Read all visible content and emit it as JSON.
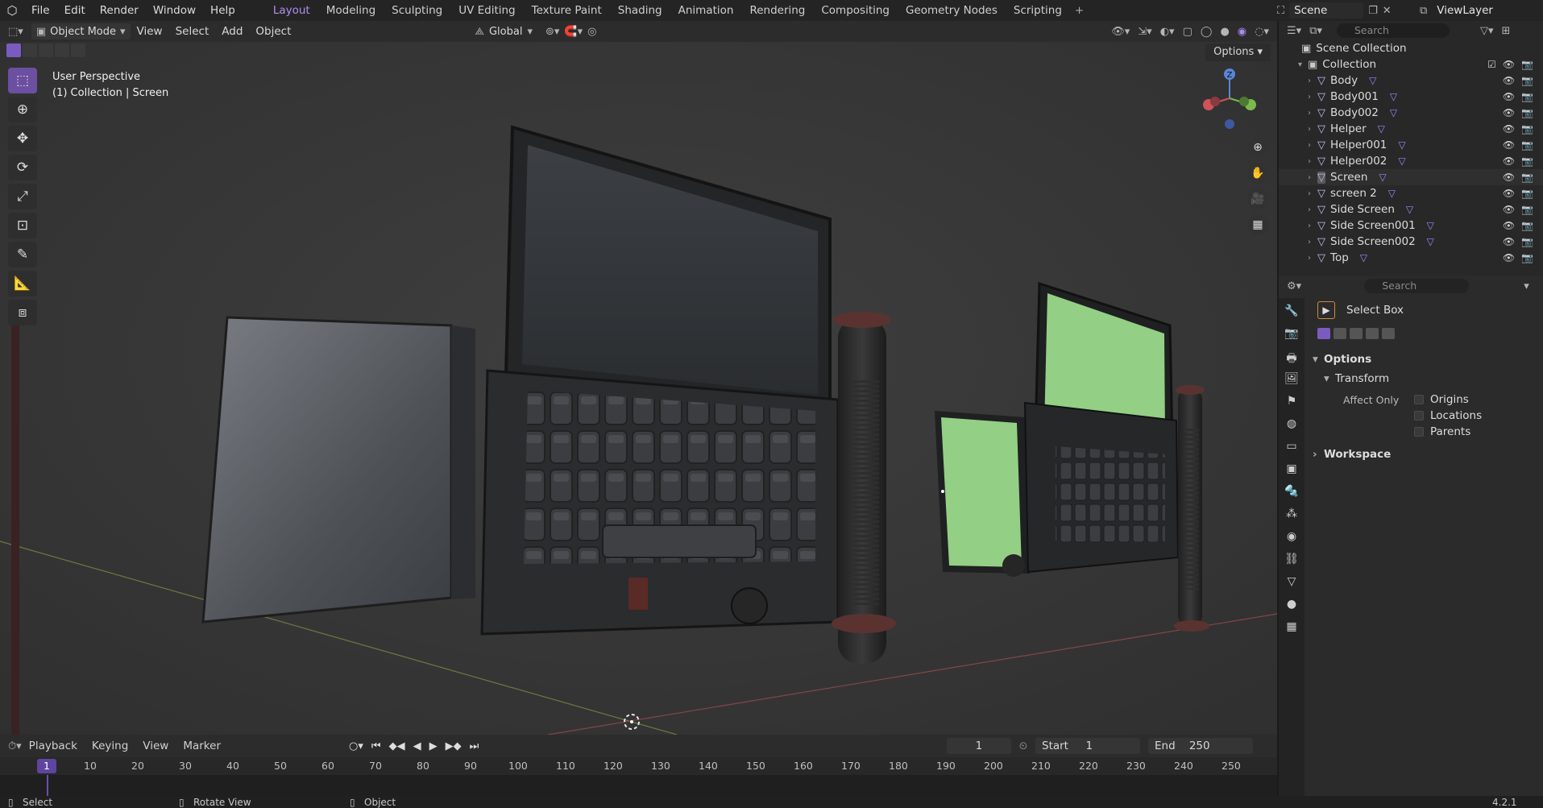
{
  "topbar": {
    "menu": [
      "File",
      "Edit",
      "Render",
      "Window",
      "Help"
    ],
    "workspaces": [
      "Layout",
      "Modeling",
      "Sculpting",
      "UV Editing",
      "Texture Paint",
      "Shading",
      "Animation",
      "Rendering",
      "Compositing",
      "Geometry Nodes",
      "Scripting"
    ],
    "active_workspace": "Layout",
    "add_tab_label": "+",
    "scene": "Scene",
    "view_layer": "ViewLayer"
  },
  "viewport_header": {
    "mode": "Object Mode",
    "menus": [
      "View",
      "Select",
      "Add",
      "Object"
    ],
    "orientation": "Global"
  },
  "viewport": {
    "perspective_label": "User Perspective",
    "collection_label": "(1) Collection | Screen",
    "options_label": "Options",
    "gizmo_axis": "Z"
  },
  "timeline": {
    "menus": [
      "Playback",
      "Keying",
      "View",
      "Marker"
    ],
    "current_frame": "1",
    "start_label": "Start",
    "start_value": "1",
    "end_label": "End",
    "end_value": "250",
    "ruler": [
      "10",
      "20",
      "30",
      "40",
      "50",
      "60",
      "70",
      "80",
      "90",
      "100",
      "110",
      "120",
      "130",
      "140",
      "150",
      "160",
      "170",
      "180",
      "190",
      "200",
      "210",
      "220",
      "230",
      "240",
      "250"
    ],
    "ruler_current": "1"
  },
  "statusbar": {
    "select": "Select",
    "rotate": "Rotate View",
    "object": "Object",
    "version": "4.2.1"
  },
  "outliner": {
    "search_placeholder": "Search",
    "root": "Scene Collection",
    "collection": "Collection",
    "objects": [
      "Body",
      "Body001",
      "Body002",
      "Helper",
      "Helper001",
      "Helper002",
      "Screen",
      "screen 2",
      "Side Screen",
      "Side Screen001",
      "Side Screen002",
      "Top"
    ]
  },
  "properties": {
    "search_placeholder": "Search",
    "tool_name": "Select Box",
    "options_label": "Options",
    "transform_label": "Transform",
    "affect_only_label": "Affect Only",
    "origins_label": "Origins",
    "locations_label": "Locations",
    "parents_label": "Parents",
    "workspace_label": "Workspace"
  },
  "colors": {
    "accent": "#7a5cc0",
    "screen_green": "#93cf85",
    "viewport_bg": "#3b3b3b"
  }
}
